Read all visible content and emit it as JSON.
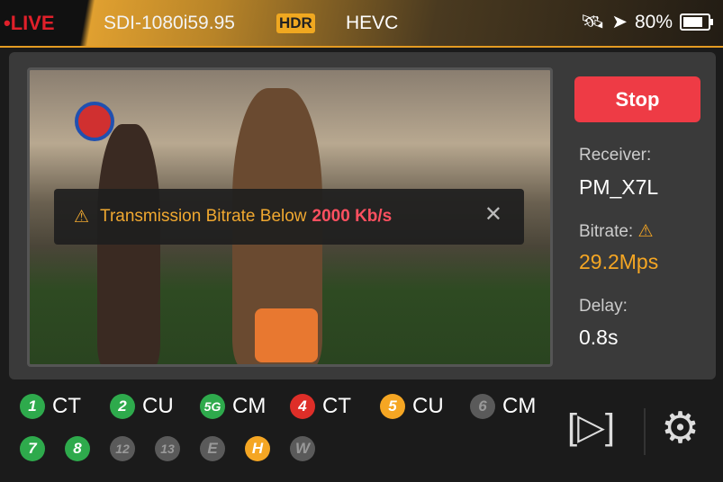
{
  "header": {
    "live": "•LIVE",
    "format": "SDI-1080i59.95",
    "hdr": "HDR",
    "codec": "HEVC",
    "battery": "80%",
    "battery_level": 0.8,
    "icons": [
      "satellite-icon",
      "location-arrow-icon",
      "battery-icon"
    ]
  },
  "alert": {
    "text": "Transmission Bitrate Below",
    "highlight": "2000 Kb/s",
    "icon": "warning-icon"
  },
  "side": {
    "stop": "Stop",
    "receiver_label": "Receiver:",
    "receiver": "PM_X7L",
    "bitrate_label": "Bitrate:",
    "bitrate": "29.2Mps",
    "delay_label": "Delay:",
    "delay": "0.8s"
  },
  "channels": [
    {
      "badge": "1",
      "label": "CT",
      "color": "#2eaa4c"
    },
    {
      "badge": "2",
      "label": "CU",
      "color": "#2eaa4c"
    },
    {
      "badge": "5G",
      "label": "CM",
      "color": "#2eaa4c"
    },
    {
      "badge": "4",
      "label": "CT",
      "color": "#de2e28"
    },
    {
      "badge": "5",
      "label": "CU",
      "color": "#f5a623"
    },
    {
      "badge": "6",
      "label": "CM",
      "color": "#5a5a5a"
    }
  ],
  "extra": [
    {
      "badge": "7",
      "color": "#2eaa4c"
    },
    {
      "badge": "8",
      "color": "#2eaa4c"
    },
    {
      "badge": "12",
      "color": "#5a5a5a"
    },
    {
      "badge": "13",
      "color": "#5a5a5a"
    },
    {
      "badge": "E",
      "color": "#5a5a5a"
    },
    {
      "badge": "H",
      "color": "#f5a623"
    },
    {
      "badge": "W",
      "color": "#5a5a5a"
    }
  ],
  "controls": {
    "record": "[▷]",
    "settings": "⚙"
  }
}
